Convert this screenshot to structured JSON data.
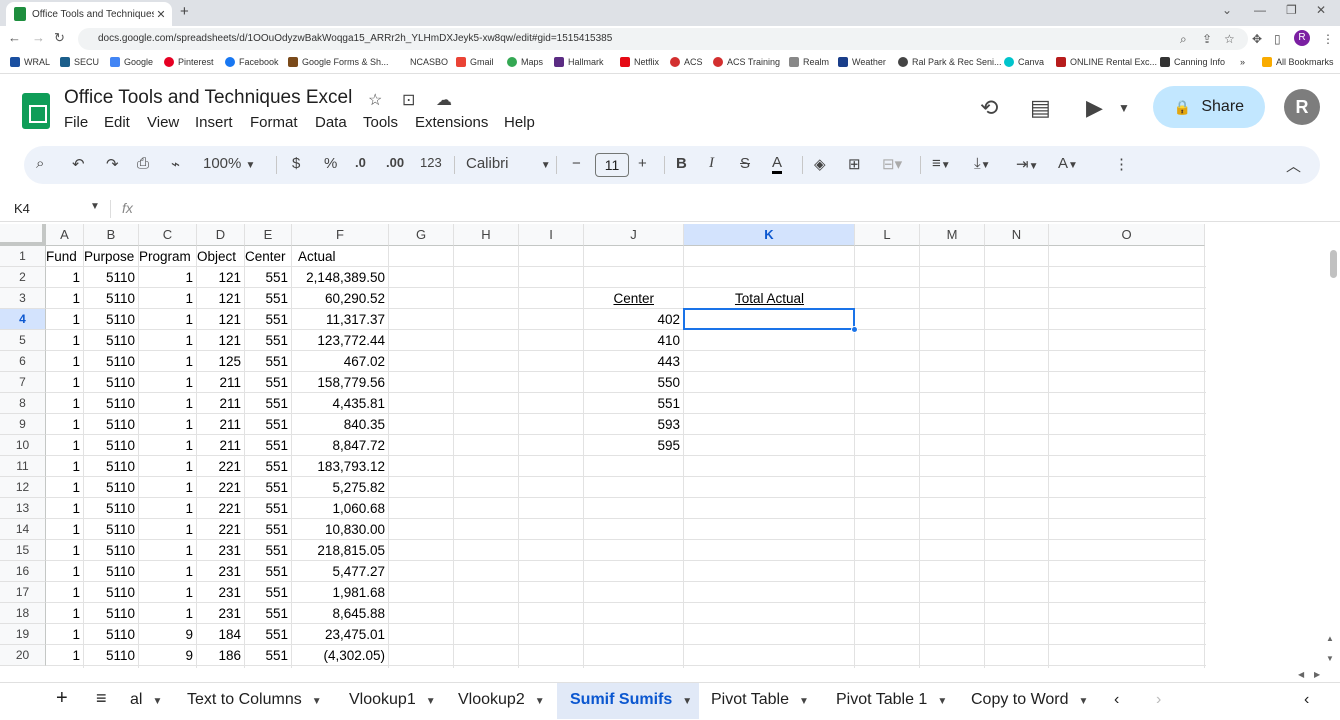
{
  "browser": {
    "tab_title": "Office Tools and Techniques Exc",
    "url": "docs.google.com/spreadsheets/d/1OOuOdyzwBakWoqga15_ARRr2h_YLHmDXJeyk5-xw8qw/edit#gid=1515415385",
    "profile_initial": "R",
    "bookmarks": [
      "WRAL",
      "SECU",
      "Google",
      "Pinterest",
      "Facebook",
      "Google Forms & Sh...",
      "NCASBO",
      "Gmail",
      "Maps",
      "Hallmark",
      "Netflix",
      "ACS",
      "ACS Training",
      "Realm",
      "Weather",
      "Ral Park & Rec Seni...",
      "Canva",
      "ONLINE Rental Exc...",
      "Canning Info",
      "All Bookmarks"
    ]
  },
  "app": {
    "doc_title": "Office Tools and Techniques Excel",
    "menu": [
      "File",
      "Edit",
      "View",
      "Insert",
      "Format",
      "Data",
      "Tools",
      "Extensions",
      "Help"
    ],
    "share_label": "Share",
    "user_initial": "R"
  },
  "toolbar": {
    "zoom": "100%",
    "currency": "$",
    "percent": "%",
    "dec_less": ".0",
    "dec_more": ".00",
    "number_format": "123",
    "font": "Calibri",
    "font_size": "11"
  },
  "formula_bar": {
    "name_box": "K4",
    "fx": "fx",
    "value": ""
  },
  "columns": [
    "A",
    "B",
    "C",
    "D",
    "E",
    "F",
    "G",
    "H",
    "I",
    "J",
    "K",
    "L",
    "M",
    "N",
    "O"
  ],
  "selected_column": "K",
  "selected_row": "4",
  "headers": [
    "Fund",
    "Purpose",
    "Program",
    "Object",
    "Center",
    "Actual"
  ],
  "rows": [
    [
      "1",
      "5110",
      "1",
      "121",
      "551",
      "2,148,389.50"
    ],
    [
      "1",
      "5110",
      "1",
      "121",
      "551",
      "60,290.52"
    ],
    [
      "1",
      "5110",
      "1",
      "121",
      "551",
      "11,317.37"
    ],
    [
      "1",
      "5110",
      "1",
      "121",
      "551",
      "123,772.44"
    ],
    [
      "1",
      "5110",
      "1",
      "125",
      "551",
      "467.02"
    ],
    [
      "1",
      "5110",
      "1",
      "211",
      "551",
      "158,779.56"
    ],
    [
      "1",
      "5110",
      "1",
      "211",
      "551",
      "4,435.81"
    ],
    [
      "1",
      "5110",
      "1",
      "211",
      "551",
      "840.35"
    ],
    [
      "1",
      "5110",
      "1",
      "211",
      "551",
      "8,847.72"
    ],
    [
      "1",
      "5110",
      "1",
      "221",
      "551",
      "183,793.12"
    ],
    [
      "1",
      "5110",
      "1",
      "221",
      "551",
      "5,275.82"
    ],
    [
      "1",
      "5110",
      "1",
      "221",
      "551",
      "1,060.68"
    ],
    [
      "1",
      "5110",
      "1",
      "221",
      "551",
      "10,830.00"
    ],
    [
      "1",
      "5110",
      "1",
      "231",
      "551",
      "218,815.05"
    ],
    [
      "1",
      "5110",
      "1",
      "231",
      "551",
      "5,477.27"
    ],
    [
      "1",
      "5110",
      "1",
      "231",
      "551",
      "1,981.68"
    ],
    [
      "1",
      "5110",
      "1",
      "231",
      "551",
      "8,645.88"
    ],
    [
      "1",
      "5110",
      "9",
      "184",
      "551",
      "23,475.01"
    ],
    [
      "1",
      "5110",
      "9",
      "186",
      "551",
      "(4,302.05)"
    ]
  ],
  "summary": {
    "center_header": "Center",
    "total_header": "Total Actual",
    "centers": [
      "402",
      "410",
      "443",
      "550",
      "551",
      "593",
      "595"
    ]
  },
  "sheet_tabs": {
    "truncated_label": "al",
    "tabs": [
      "Text to Columns",
      "Vlookup1",
      "Vlookup2",
      "Sumif Sumifs",
      "Pivot Table",
      "Pivot Table 1",
      "Copy to Word"
    ],
    "active": "Sumif Sumifs"
  }
}
